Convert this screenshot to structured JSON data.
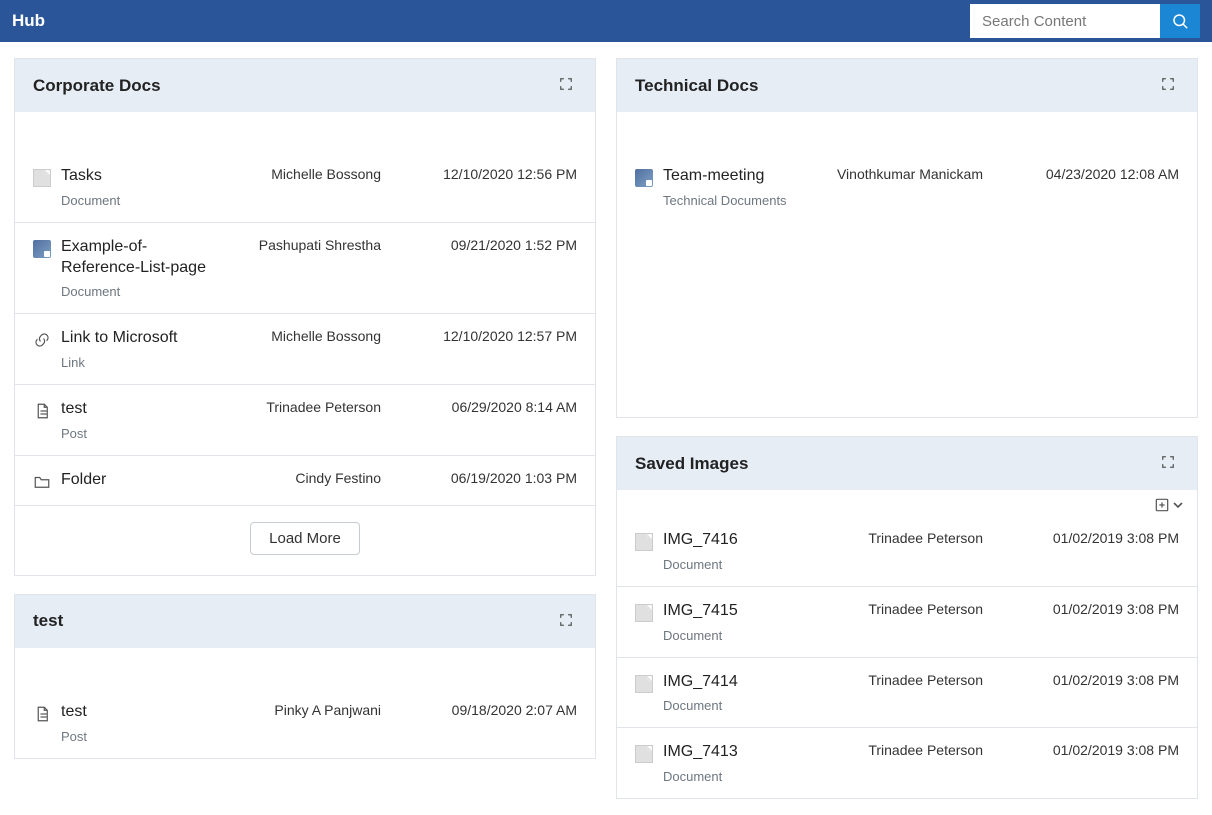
{
  "app": {
    "title": "Hub"
  },
  "search": {
    "placeholder": "Search Content"
  },
  "panels": {
    "corporate": {
      "title": "Corporate Docs",
      "items": [
        {
          "icon": "doc",
          "title": "Tasks",
          "type": "Document",
          "author": "Michelle Bossong",
          "time": "12/10/2020 12:56 PM"
        },
        {
          "icon": "thumb",
          "title": "Example-of-Reference-List-page",
          "type": "Document",
          "author": "Pashupati Shrestha",
          "time": "09/21/2020 1:52 PM"
        },
        {
          "icon": "link",
          "title": "Link to Microsoft",
          "type": "Link",
          "author": "Michelle Bossong",
          "time": "12/10/2020 12:57 PM"
        },
        {
          "icon": "post",
          "title": "test",
          "type": "Post",
          "author": "Trinadee Peterson",
          "time": "06/29/2020 8:14 AM"
        },
        {
          "icon": "folder",
          "title": "Folder",
          "type": "",
          "author": "Cindy Festino",
          "time": "06/19/2020 1:03 PM"
        }
      ],
      "load_more_label": "Load More"
    },
    "test": {
      "title": "test",
      "items": [
        {
          "icon": "post",
          "title": "test",
          "type": "Post",
          "author": "Pinky A Panjwani",
          "time": "09/18/2020 2:07 AM"
        }
      ]
    },
    "technical": {
      "title": "Technical Docs",
      "items": [
        {
          "icon": "thumb",
          "title": "Team-meeting",
          "type": "Technical Documents",
          "author": "Vinothkumar Manickam",
          "time": "04/23/2020 12:08 AM"
        }
      ]
    },
    "saved_images": {
      "title": "Saved Images",
      "items": [
        {
          "icon": "doc",
          "title": "IMG_7416",
          "type": "Document",
          "author": "Trinadee Peterson",
          "time": "01/02/2019 3:08 PM"
        },
        {
          "icon": "doc",
          "title": "IMG_7415",
          "type": "Document",
          "author": "Trinadee Peterson",
          "time": "01/02/2019 3:08 PM"
        },
        {
          "icon": "doc",
          "title": "IMG_7414",
          "type": "Document",
          "author": "Trinadee Peterson",
          "time": "01/02/2019 3:08 PM"
        },
        {
          "icon": "doc",
          "title": "IMG_7413",
          "type": "Document",
          "author": "Trinadee Peterson",
          "time": "01/02/2019 3:08 PM"
        }
      ]
    }
  }
}
